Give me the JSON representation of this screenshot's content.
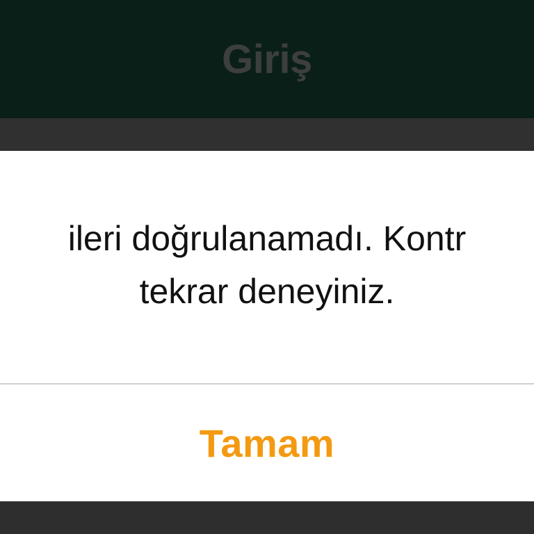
{
  "navbar": {
    "title": "Giriş"
  },
  "alert": {
    "message_line_1": "ileri doğrulanamadı. Kontr",
    "message_line_2": "tekrar deneyiniz.",
    "ok_label": "Tamam"
  },
  "colors": {
    "navbar_background": "#0b1f19",
    "navbar_title": "#3c3f3e",
    "dim_overlay": "#2e2e2e",
    "alert_background": "#ffffff",
    "message_text": "#111111",
    "divider": "#d0d0d0",
    "accent": "#f39a12"
  }
}
